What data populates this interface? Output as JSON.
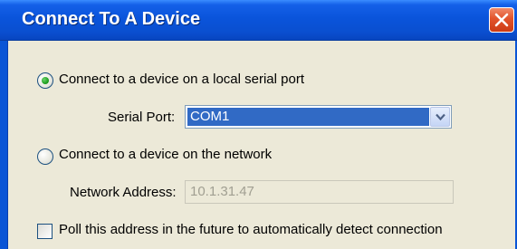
{
  "window": {
    "title": "Connect To A Device",
    "close_icon": "close-icon"
  },
  "options": {
    "serial_radio_label": "Connect to a device on a local serial port",
    "serial_selected": true,
    "network_radio_label": "Connect to a device on the network",
    "network_selected": false
  },
  "serial": {
    "label": "Serial Port:",
    "selected_value": "COM1"
  },
  "network": {
    "label": "Network Address:",
    "value": "10.1.31.47",
    "enabled": false
  },
  "poll": {
    "label": "Poll this address in the future to automatically detect connection",
    "checked": false
  },
  "colors": {
    "title_bar": "#0a54db",
    "dialog_bg": "#ece9d8",
    "selection": "#316ac5",
    "close_button": "#e2532b"
  }
}
